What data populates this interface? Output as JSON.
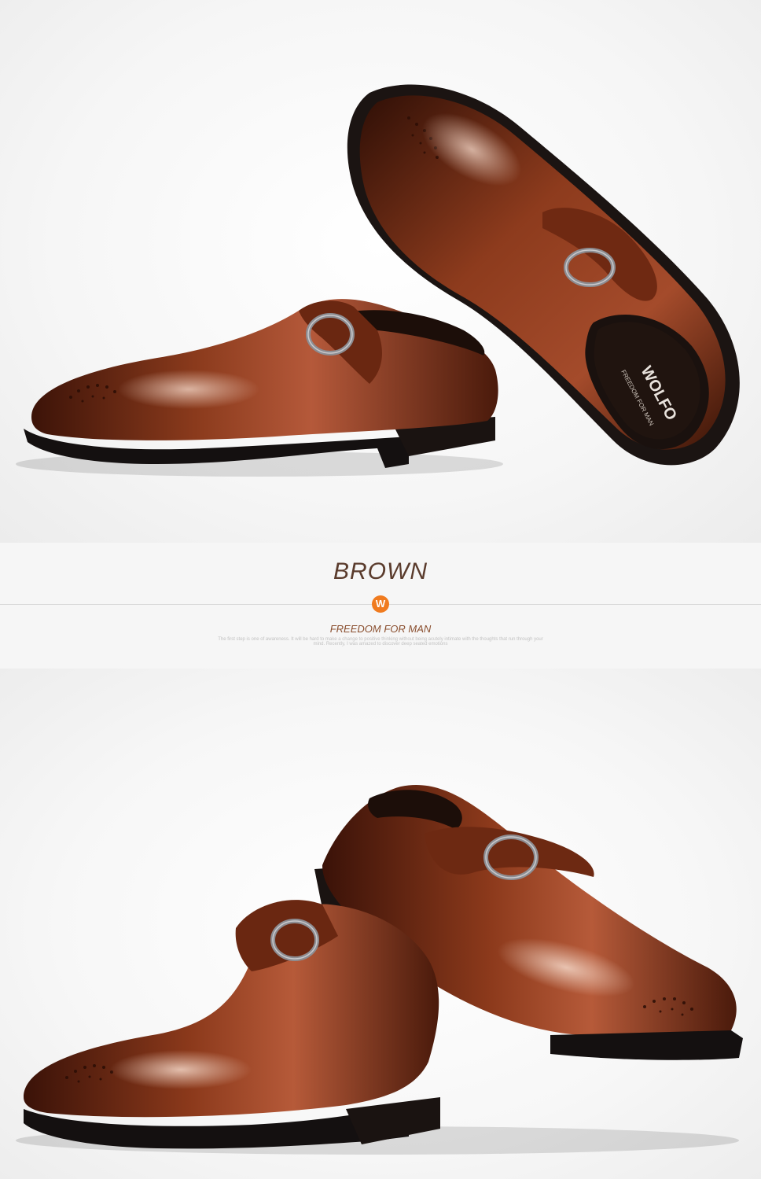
{
  "caption": {
    "color_name": "BROWN",
    "logo_letter": "W",
    "tagline": "FREEDOM FOR MAN",
    "fine_print": "The first step is one of awareness. It will be hard to make a change to positive thinking without being acutely intimate with the thoughts that run through your mind. Recently, I was amazed to discover deep seated emotions"
  },
  "insole_brand": "WOLFO",
  "insole_slogan": "FREEDOM FOR MAN",
  "colors": {
    "leather": "#7a2e14",
    "leather_dark": "#3c1308",
    "leather_light": "#b5593a",
    "sole": "#141010",
    "buckle": "#8d8d92",
    "accent": "#f07b1f"
  }
}
